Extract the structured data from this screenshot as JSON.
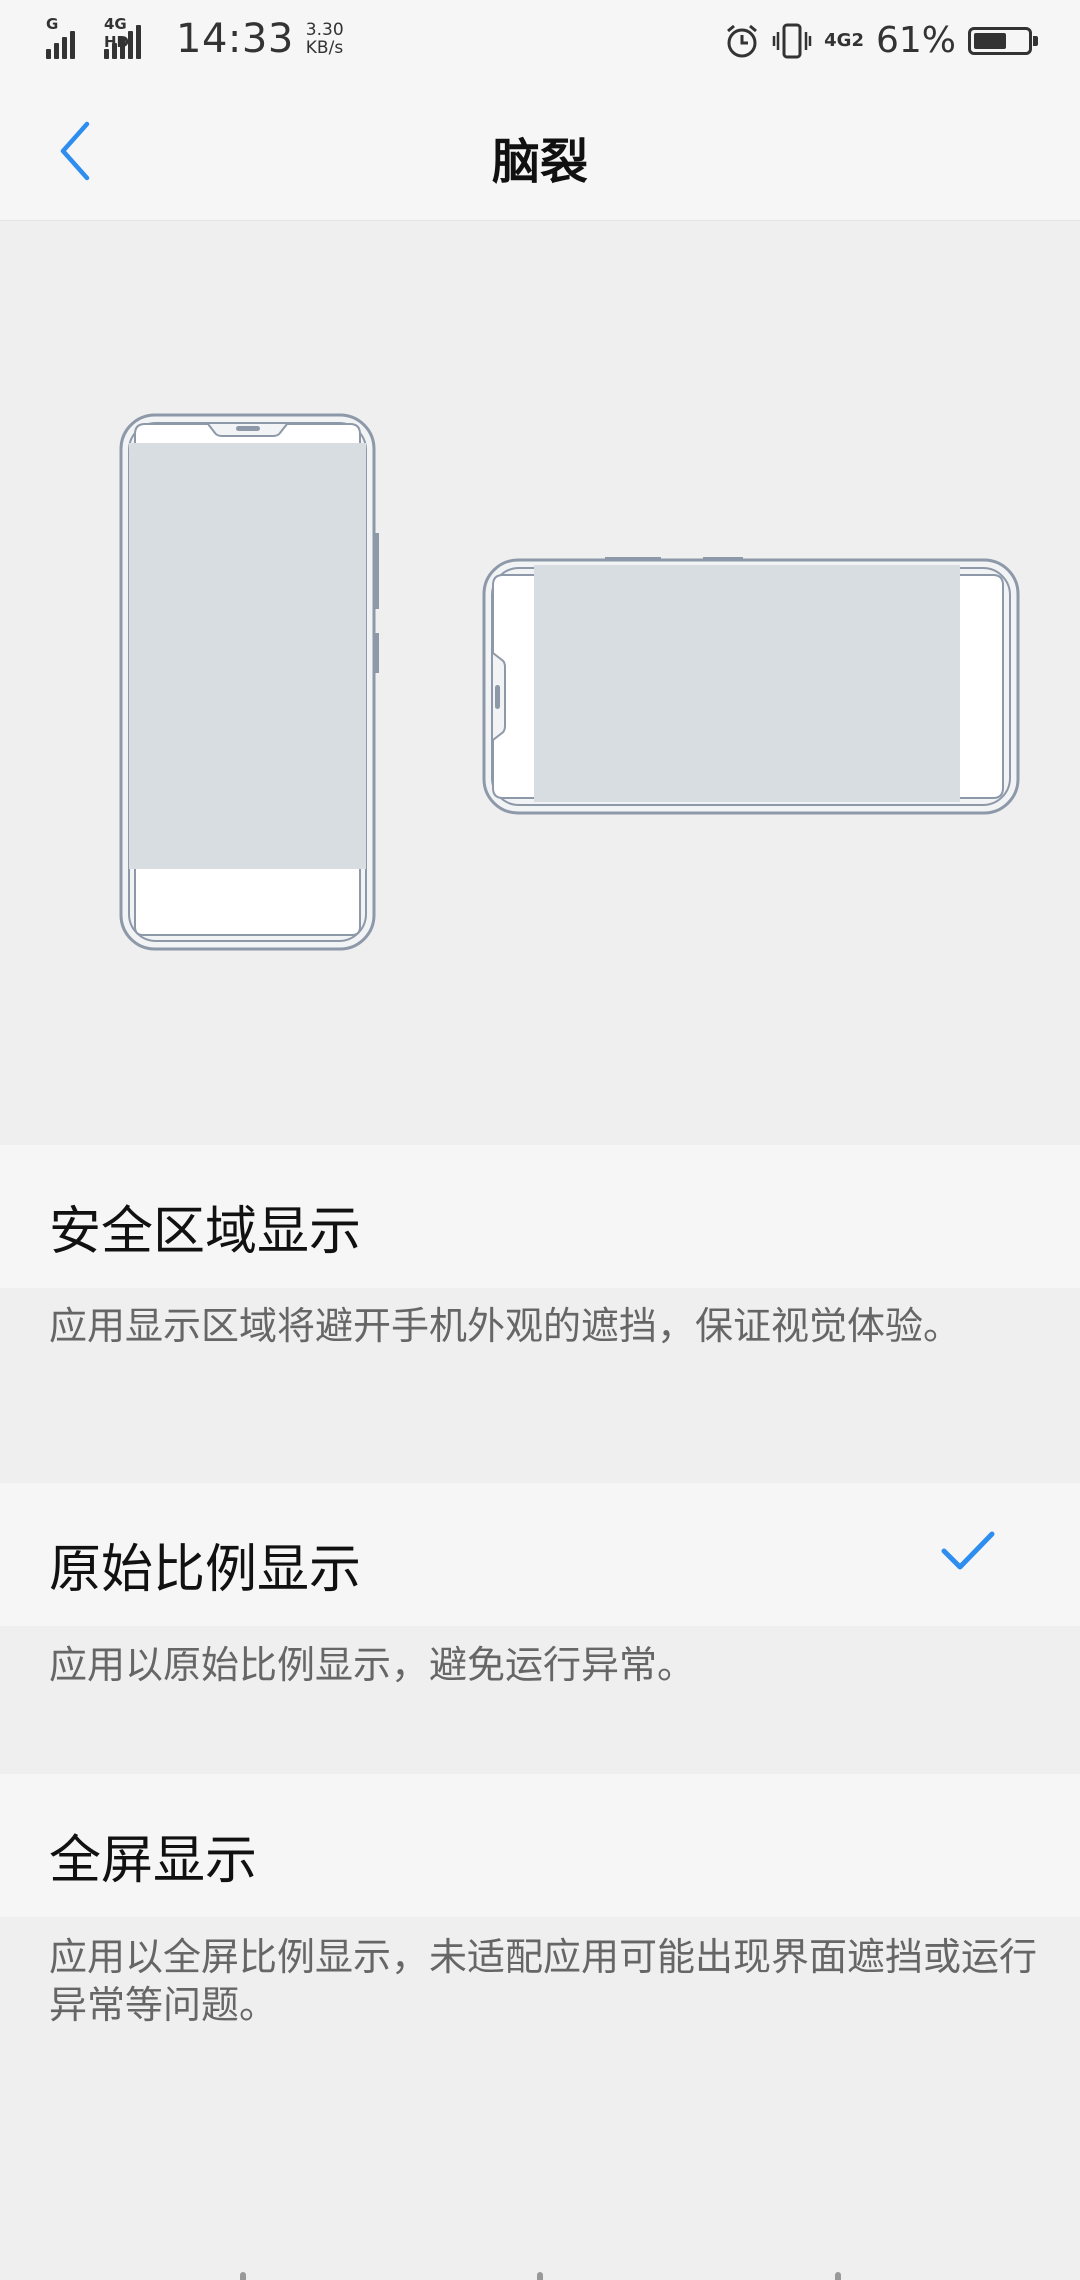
{
  "status_bar": {
    "sim1_tag": "G",
    "sim2_tag": "4G HD",
    "time": "14:33",
    "speed_value": "3.30",
    "speed_unit": "KB/s",
    "network_tag": "4G2",
    "battery_percent": "61%",
    "battery_level": 0.61,
    "icons": [
      "signal-icon",
      "signal-icon",
      "alarm-icon",
      "vibrate-icon",
      "network-icon",
      "battery-icon"
    ]
  },
  "header": {
    "title": "脑裂",
    "back_icon": "chevron-left-icon"
  },
  "options": [
    {
      "label": "安全区域显示",
      "description": "应用显示区域将避开手机外观的遮挡，保证视觉体验。",
      "selected": false
    },
    {
      "label": "原始比例显示",
      "description": "应用以原始比例显示，避免运行异常。",
      "selected": true
    },
    {
      "label": "全屏显示",
      "description": "应用以全屏比例显示，未适配应用可能出现界面遮挡或运行异常等问题。",
      "selected": false
    }
  ],
  "colors": {
    "accent": "#2e8ef0",
    "background": "#efefef",
    "row_background": "#f6f6f6",
    "description_text": "#666666",
    "phone_outline": "#8d98a8",
    "phone_screen": "#d8dde1"
  }
}
